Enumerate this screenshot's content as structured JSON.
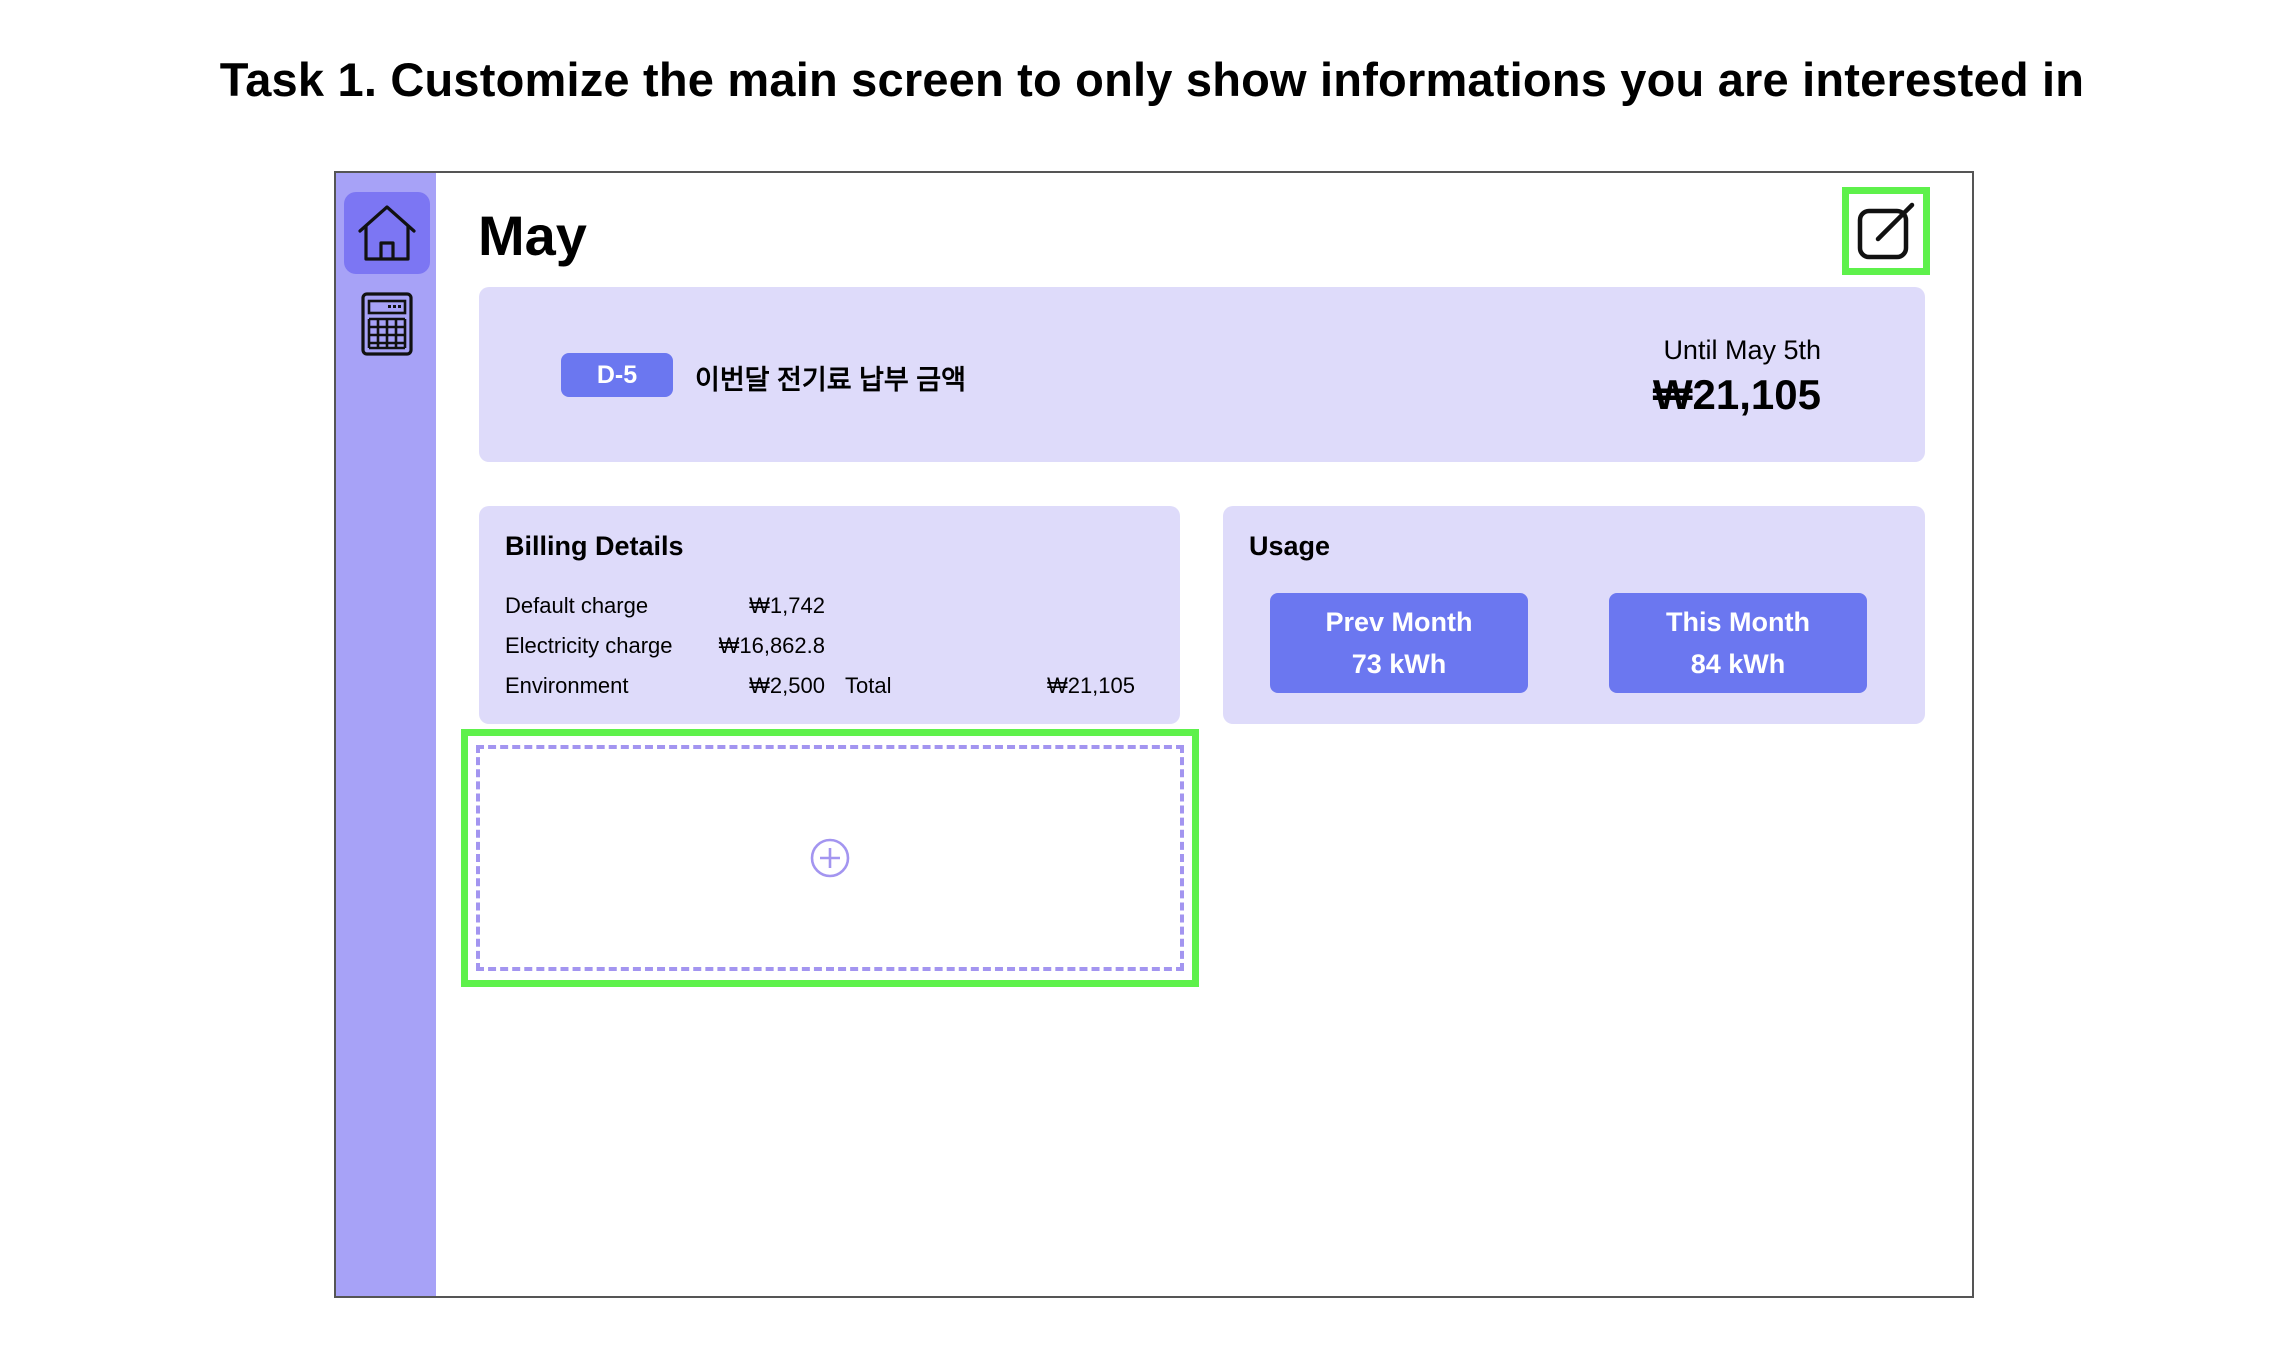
{
  "task": {
    "title": "Task 1. Customize the main screen to only show informations you are interested in"
  },
  "sidebar": {
    "items": [
      {
        "icon": "home-icon",
        "active": true
      },
      {
        "icon": "calculator-icon",
        "active": false
      }
    ]
  },
  "header": {
    "title": "May",
    "edit_icon": "edit-icon"
  },
  "banner": {
    "badge": "D-5",
    "label": "이번달 전기료 납부 금액",
    "until": "Until May 5th",
    "amount": "₩21,105"
  },
  "billing": {
    "title": "Billing Details",
    "rows": [
      {
        "label": "Default charge",
        "value": "₩1,742"
      },
      {
        "label": "Electricity charge",
        "value": "₩16,862.8"
      },
      {
        "label": "Environment",
        "value": "₩2,500"
      }
    ],
    "total_label": "Total",
    "total_value": "₩21,105"
  },
  "usage": {
    "title": "Usage",
    "prev": {
      "label": "Prev Month",
      "value": "73 kWh"
    },
    "current": {
      "label": "This Month",
      "value": "84 kWh"
    }
  },
  "add_slot": {
    "icon": "plus-circle-icon"
  },
  "colors": {
    "sidebar": "#a7a2f7",
    "sidebar_active": "#7c76f3",
    "card": "#dedbfa",
    "accent": "#6b77f0",
    "highlight": "#5ef14b",
    "dashed": "#a395f0"
  }
}
